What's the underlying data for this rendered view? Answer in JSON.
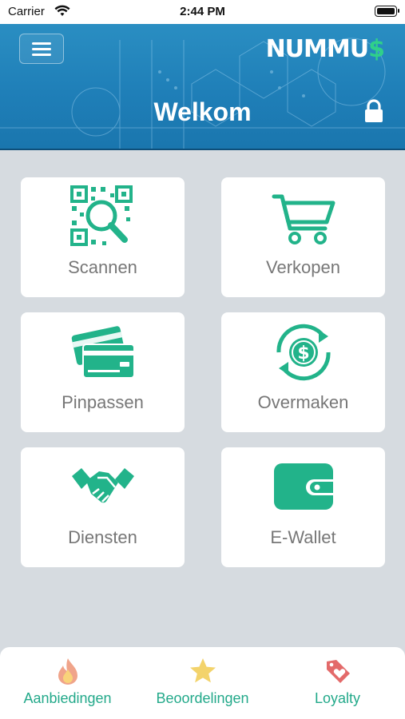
{
  "status_bar": {
    "carrier": "Carrier",
    "time": "2:44 PM"
  },
  "header": {
    "logo_part1": "NUMMU",
    "logo_part2": "$",
    "title": "Welkom",
    "colors": {
      "bar": "#1f7fb8",
      "logo_accent": "#2fd08a"
    }
  },
  "tiles": [
    {
      "label": "Scannen",
      "icon": "qr-scan-icon"
    },
    {
      "label": "Verkopen",
      "icon": "shopping-cart-icon"
    },
    {
      "label": "Pinpassen",
      "icon": "credit-cards-icon"
    },
    {
      "label": "Overmaken",
      "icon": "money-transfer-icon"
    },
    {
      "label": "Diensten",
      "icon": "handshake-icon"
    },
    {
      "label": "E-Wallet",
      "icon": "wallet-icon"
    }
  ],
  "accent_color": "#22b38a",
  "bottom_nav": [
    {
      "label": "Aanbiedingen",
      "icon": "flame-icon"
    },
    {
      "label": "Beoordelingen",
      "icon": "star-icon"
    },
    {
      "label": "Loyalty",
      "icon": "heart-tag-icon"
    }
  ]
}
